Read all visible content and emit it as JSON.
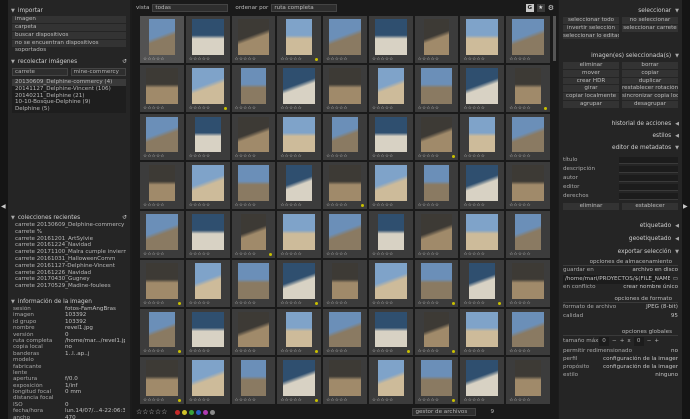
{
  "left": {
    "import": {
      "title": "importar",
      "buttons": [
        "imagen",
        "carpeta",
        "buscar dispositivos",
        "no se encuentran dispositivos soportados"
      ]
    },
    "collect": {
      "title": "recolectar imágenes",
      "sel1": "carrete",
      "sel2": "mine-commercy",
      "items": [
        "20130609_Delphine-commercy (4)",
        "20141127_Delphine-Vincent (106)",
        "20140211_Delphine (21)",
        "10-10-Bosque-Delphine (9)",
        "Delphine (5)"
      ]
    },
    "recent": {
      "title": "colecciones recientes",
      "items": [
        "carrete 20130609_Delphine-commercy",
        "carrete %",
        "carrete 20161201_ArtSylvie",
        "carrete 20161224_Navidad",
        "carrete 20171100_Malra cumple invierno",
        "carrete 20161031_HalloweenComm",
        "carrete 20161127-Delphine-Vincent",
        "carrete 20161226_Navidad",
        "carrete 20170430_Gugney",
        "carrete 20170529_Madine-foulees"
      ]
    },
    "info": {
      "title": "información de la imagen",
      "rows": [
        {
          "k": "sesión",
          "v": "fotos-FamAngBras"
        },
        {
          "k": "imagen",
          "v": "103392"
        },
        {
          "k": "id grupo",
          "v": "103392"
        },
        {
          "k": "nombre",
          "v": "revel1.jpg"
        },
        {
          "k": "versión",
          "v": "0"
        },
        {
          "k": "ruta completa",
          "v": "/home/mar.../revel1.jpg"
        },
        {
          "k": "copia local",
          "v": "no"
        },
        {
          "k": "banderas",
          "v": "1..l..ap..j"
        },
        {
          "k": "modelo",
          "v": ""
        },
        {
          "k": "fabricante",
          "v": ""
        },
        {
          "k": "lente",
          "v": ""
        },
        {
          "k": "apertura",
          "v": "f/0.0"
        },
        {
          "k": "exposición",
          "v": "1/inf"
        },
        {
          "k": "longitud focal",
          "v": "0 mm"
        },
        {
          "k": "distancia focal",
          "v": ""
        },
        {
          "k": "ISO",
          "v": "0"
        },
        {
          "k": "fecha/hora",
          "v": "lun.14/07/...4-22:06:31"
        },
        {
          "k": "ancho",
          "v": "470"
        }
      ]
    }
  },
  "top": {
    "vista_label": "vista",
    "vista_value": "todas",
    "orden_label": "ordenar por",
    "orden_value": "ruta completa",
    "btn_g": "G",
    "btn_star": "★"
  },
  "bottom": {
    "stars": "☆☆☆☆☆",
    "module": "gestor de archivos",
    "zoom": "9"
  },
  "right": {
    "select": {
      "title": "seleccionar",
      "buttons": [
        "seleccionar todo",
        "no seleccionar",
        "invertir selección",
        "seleccionar carrete",
        "seleccionar lo editado",
        ""
      ]
    },
    "selected": {
      "title": "imagen(es) seleccionada(s)",
      "buttons": [
        "eliminar",
        "borrar",
        "mover",
        "copiar",
        "crear HDR",
        "duplicar",
        "girar",
        "restablecer rotación",
        "copiar localmente",
        "sincronizar copia local",
        "agrupar",
        "desagrupar"
      ]
    },
    "stacks": [
      {
        "t": "historial de acciones"
      },
      {
        "t": "estilos"
      },
      {
        "t": "editor de metadatos"
      }
    ],
    "meta": {
      "rows": [
        "título",
        "descripción",
        "autor",
        "editor",
        "derechos"
      ],
      "btn_del": "eliminar",
      "btn_set": "establecer"
    },
    "more": [
      {
        "t": "etiquetado"
      },
      {
        "t": "geoetiquetado"
      },
      {
        "t": "exportar selección"
      }
    ],
    "export": {
      "storage_title": "opciones de almacenamiento",
      "save_k": "guardar en",
      "save_v": "archivo en disco",
      "path": "/home/mari/PROYECTOS/$(FILE_NAME)",
      "conflict_k": "en conflicto",
      "conflict_v": "crear nombre único",
      "format_title": "opciones de formato",
      "format_k": "formato de archivo",
      "format_v": "JPEG (8-bit)",
      "quality_k": "calidad",
      "quality_v": "95",
      "global_title": "opciones globales",
      "size_k": "tamaño máx",
      "size_w": "0",
      "size_x": "x",
      "size_h": "0",
      "upscale_k": "permitir redimensionado",
      "upscale_v": "no",
      "profile_k": "perfil",
      "profile_v": "configuración de la imagen",
      "intent_k": "propósito",
      "intent_v": "configuración de la imagen",
      "style_k": "estilo",
      "style_v": "ninguno"
    }
  },
  "colors": {
    "accent": "#c8c000",
    "bg": "#1c1c1c",
    "panel": "#252525"
  },
  "labels": [
    "#c42a2a",
    "#cfc32b",
    "#3aa33a",
    "#2a5fc4",
    "#b03ab0",
    "#8a8a8a"
  ]
}
